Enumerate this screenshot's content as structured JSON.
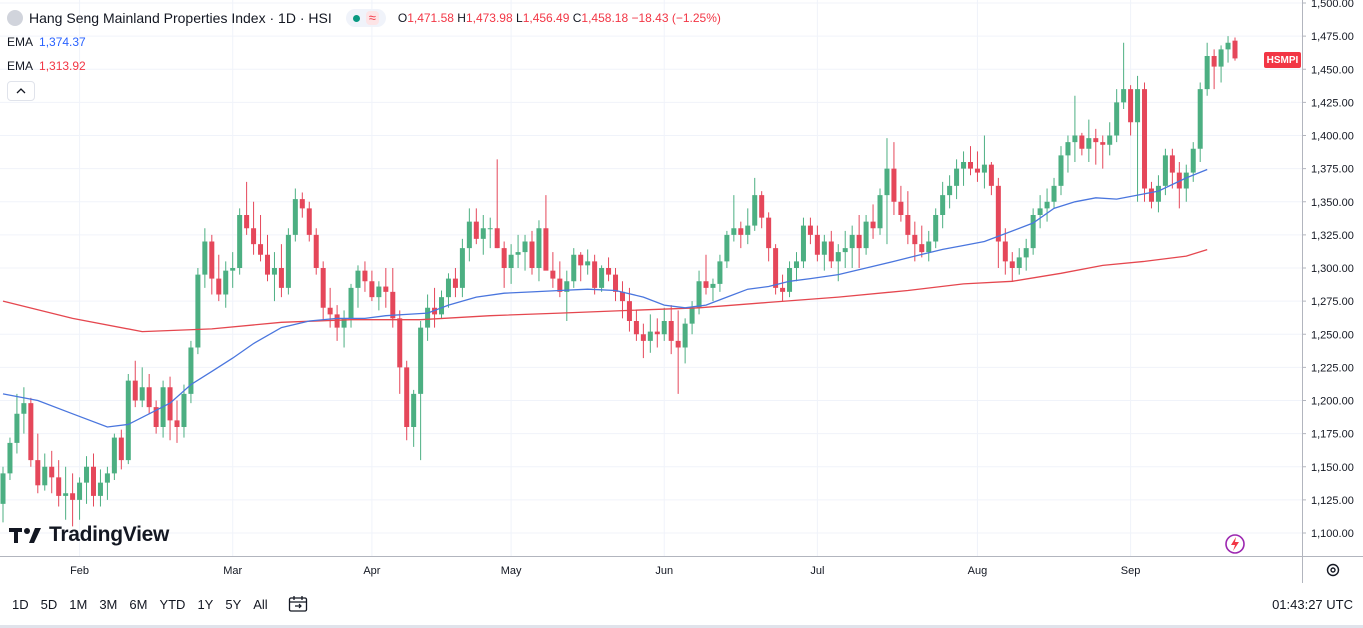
{
  "header": {
    "symbol_title": "Hang Seng Mainland Properties Index · 1D · HSI",
    "ohlc": {
      "open_label": "O",
      "open": "1,471.58",
      "high_label": "H",
      "high": "1,473.98",
      "low_label": "L",
      "low": "1,456.49",
      "close_label": "C",
      "close": "1,458.18",
      "change": "−18.43 (−1.25%)"
    }
  },
  "indicators": [
    {
      "label": "EMA",
      "value": "1,374.37",
      "color": "#2962ff"
    },
    {
      "label": "EMA",
      "value": "1,313.92",
      "color": "#f23645"
    }
  ],
  "collapse_glyph": "^",
  "symbol_tag": "HSMPI",
  "logo_text": "TradingView",
  "logo_mark": "TV",
  "timeframes": [
    "1D",
    "5D",
    "1M",
    "3M",
    "6M",
    "YTD",
    "1Y",
    "5Y",
    "All"
  ],
  "clock": "01:43:27 UTC",
  "colors": {
    "up": "#4caf82",
    "down": "#e5475a",
    "ema_fast": "#4a76de",
    "ema_slow": "#e5474f",
    "grid": "#f0f3fa"
  },
  "chart_data": {
    "type": "candlestick",
    "title": "Hang Seng Mainland Properties Index · 1D · HSI",
    "y_ticks": [
      "1,100.00",
      "1,125.00",
      "1,150.00",
      "1,175.00",
      "1,200.00",
      "1,225.00",
      "1,250.00",
      "1,275.00",
      "1,300.00",
      "1,325.00",
      "1,350.00",
      "1,375.00",
      "1,400.00",
      "1,425.00",
      "1,450.00",
      "1,475.00",
      "1,500.00"
    ],
    "y_tick_values": [
      1100,
      1125,
      1150,
      1175,
      1200,
      1225,
      1250,
      1275,
      1300,
      1325,
      1350,
      1375,
      1400,
      1425,
      1450,
      1475,
      1500
    ],
    "ylim": [
      1082,
      1501
    ],
    "x_labels": [
      {
        "label": "Feb",
        "index": 11
      },
      {
        "label": "Mar",
        "index": 33
      },
      {
        "label": "Apr",
        "index": 53
      },
      {
        "label": "May",
        "index": 73
      },
      {
        "label": "Jun",
        "index": 95
      },
      {
        "label": "Jul",
        "index": 117
      },
      {
        "label": "Aug",
        "index": 140
      },
      {
        "label": "Sep",
        "index": 162
      }
    ],
    "x_range": [
      0,
      179
    ],
    "candles": [
      [
        1122,
        1150,
        1108,
        1145
      ],
      [
        1145,
        1172,
        1140,
        1168
      ],
      [
        1168,
        1205,
        1160,
        1190
      ],
      [
        1190,
        1210,
        1175,
        1198
      ],
      [
        1198,
        1202,
        1150,
        1155
      ],
      [
        1155,
        1175,
        1130,
        1136
      ],
      [
        1136,
        1160,
        1132,
        1150
      ],
      [
        1150,
        1162,
        1130,
        1142
      ],
      [
        1142,
        1155,
        1120,
        1128
      ],
      [
        1128,
        1150,
        1110,
        1130
      ],
      [
        1130,
        1145,
        1105,
        1125
      ],
      [
        1125,
        1142,
        1110,
        1138
      ],
      [
        1138,
        1158,
        1122,
        1150
      ],
      [
        1150,
        1160,
        1120,
        1128
      ],
      [
        1128,
        1148,
        1120,
        1138
      ],
      [
        1138,
        1150,
        1125,
        1145
      ],
      [
        1145,
        1175,
        1140,
        1172
      ],
      [
        1172,
        1178,
        1148,
        1155
      ],
      [
        1155,
        1220,
        1152,
        1215
      ],
      [
        1215,
        1230,
        1195,
        1200
      ],
      [
        1200,
        1225,
        1195,
        1210
      ],
      [
        1210,
        1220,
        1190,
        1195
      ],
      [
        1195,
        1200,
        1175,
        1180
      ],
      [
        1180,
        1215,
        1172,
        1210
      ],
      [
        1210,
        1218,
        1170,
        1185
      ],
      [
        1185,
        1200,
        1168,
        1180
      ],
      [
        1180,
        1212,
        1172,
        1205
      ],
      [
        1205,
        1245,
        1198,
        1240
      ],
      [
        1240,
        1300,
        1235,
        1295
      ],
      [
        1295,
        1330,
        1285,
        1320
      ],
      [
        1320,
        1325,
        1280,
        1292
      ],
      [
        1292,
        1310,
        1275,
        1280
      ],
      [
        1280,
        1305,
        1270,
        1298
      ],
      [
        1298,
        1312,
        1285,
        1300
      ],
      [
        1300,
        1345,
        1295,
        1340
      ],
      [
        1340,
        1365,
        1325,
        1330
      ],
      [
        1330,
        1350,
        1310,
        1318
      ],
      [
        1318,
        1340,
        1305,
        1310
      ],
      [
        1310,
        1325,
        1290,
        1295
      ],
      [
        1295,
        1312,
        1275,
        1300
      ],
      [
        1300,
        1318,
        1278,
        1285
      ],
      [
        1285,
        1330,
        1280,
        1325
      ],
      [
        1325,
        1360,
        1320,
        1352
      ],
      [
        1352,
        1357,
        1338,
        1345
      ],
      [
        1345,
        1350,
        1320,
        1325
      ],
      [
        1325,
        1330,
        1295,
        1300
      ],
      [
        1300,
        1305,
        1260,
        1270
      ],
      [
        1270,
        1285,
        1255,
        1265
      ],
      [
        1265,
        1272,
        1245,
        1255
      ],
      [
        1255,
        1268,
        1240,
        1262
      ],
      [
        1262,
        1288,
        1255,
        1285
      ],
      [
        1285,
        1302,
        1270,
        1298
      ],
      [
        1298,
        1305,
        1282,
        1290
      ],
      [
        1290,
        1298,
        1275,
        1278
      ],
      [
        1278,
        1290,
        1268,
        1286
      ],
      [
        1286,
        1300,
        1270,
        1282
      ],
      [
        1282,
        1300,
        1255,
        1262
      ],
      [
        1262,
        1268,
        1205,
        1225
      ],
      [
        1225,
        1230,
        1170,
        1180
      ],
      [
        1180,
        1208,
        1165,
        1205
      ],
      [
        1205,
        1260,
        1155,
        1255
      ],
      [
        1255,
        1280,
        1245,
        1270
      ],
      [
        1270,
        1285,
        1255,
        1265
      ],
      [
        1265,
        1283,
        1262,
        1278
      ],
      [
        1278,
        1296,
        1270,
        1292
      ],
      [
        1292,
        1300,
        1278,
        1285
      ],
      [
        1285,
        1322,
        1278,
        1315
      ],
      [
        1315,
        1345,
        1305,
        1335
      ],
      [
        1335,
        1345,
        1318,
        1322
      ],
      [
        1322,
        1340,
        1310,
        1330
      ],
      [
        1330,
        1338,
        1315,
        1330
      ],
      [
        1330,
        1382,
        1315,
        1315
      ],
      [
        1315,
        1320,
        1285,
        1300
      ],
      [
        1300,
        1318,
        1288,
        1310
      ],
      [
        1310,
        1325,
        1300,
        1312
      ],
      [
        1312,
        1325,
        1298,
        1320
      ],
      [
        1320,
        1328,
        1295,
        1300
      ],
      [
        1300,
        1336,
        1290,
        1330
      ],
      [
        1330,
        1355,
        1308,
        1298
      ],
      [
        1298,
        1312,
        1285,
        1292
      ],
      [
        1292,
        1305,
        1278,
        1282
      ],
      [
        1282,
        1298,
        1260,
        1290
      ],
      [
        1290,
        1315,
        1285,
        1310
      ],
      [
        1310,
        1312,
        1290,
        1302
      ],
      [
        1302,
        1314,
        1295,
        1305
      ],
      [
        1305,
        1310,
        1280,
        1285
      ],
      [
        1285,
        1302,
        1282,
        1300
      ],
      [
        1300,
        1308,
        1290,
        1295
      ],
      [
        1295,
        1300,
        1275,
        1282
      ],
      [
        1282,
        1290,
        1262,
        1275
      ],
      [
        1275,
        1285,
        1252,
        1260
      ],
      [
        1260,
        1268,
        1245,
        1250
      ],
      [
        1250,
        1258,
        1232,
        1245
      ],
      [
        1245,
        1265,
        1236,
        1252
      ],
      [
        1252,
        1262,
        1240,
        1250
      ],
      [
        1250,
        1270,
        1245,
        1260
      ],
      [
        1260,
        1272,
        1235,
        1245
      ],
      [
        1245,
        1268,
        1205,
        1240
      ],
      [
        1240,
        1262,
        1228,
        1258
      ],
      [
        1258,
        1275,
        1250,
        1270
      ],
      [
        1270,
        1298,
        1265,
        1290
      ],
      [
        1290,
        1310,
        1280,
        1285
      ],
      [
        1285,
        1292,
        1275,
        1288
      ],
      [
        1288,
        1310,
        1282,
        1305
      ],
      [
        1305,
        1328,
        1300,
        1325
      ],
      [
        1325,
        1355,
        1320,
        1330
      ],
      [
        1330,
        1335,
        1315,
        1325
      ],
      [
        1325,
        1345,
        1318,
        1332
      ],
      [
        1332,
        1368,
        1328,
        1355
      ],
      [
        1355,
        1358,
        1330,
        1338
      ],
      [
        1338,
        1342,
        1305,
        1315
      ],
      [
        1315,
        1318,
        1280,
        1285
      ],
      [
        1285,
        1295,
        1275,
        1282
      ],
      [
        1282,
        1305,
        1278,
        1300
      ],
      [
        1300,
        1312,
        1290,
        1305
      ],
      [
        1305,
        1338,
        1300,
        1332
      ],
      [
        1332,
        1338,
        1318,
        1325
      ],
      [
        1325,
        1332,
        1305,
        1310
      ],
      [
        1310,
        1325,
        1298,
        1320
      ],
      [
        1320,
        1328,
        1300,
        1305
      ],
      [
        1305,
        1318,
        1290,
        1312
      ],
      [
        1312,
        1328,
        1300,
        1315
      ],
      [
        1315,
        1332,
        1300,
        1325
      ],
      [
        1325,
        1340,
        1300,
        1315
      ],
      [
        1315,
        1340,
        1310,
        1335
      ],
      [
        1335,
        1348,
        1322,
        1330
      ],
      [
        1330,
        1360,
        1325,
        1355
      ],
      [
        1355,
        1398,
        1318,
        1375
      ],
      [
        1375,
        1395,
        1340,
        1350
      ],
      [
        1350,
        1362,
        1335,
        1340
      ],
      [
        1340,
        1358,
        1318,
        1325
      ],
      [
        1325,
        1335,
        1305,
        1318
      ],
      [
        1318,
        1332,
        1308,
        1312
      ],
      [
        1312,
        1328,
        1305,
        1320
      ],
      [
        1320,
        1345,
        1315,
        1340
      ],
      [
        1340,
        1365,
        1330,
        1355
      ],
      [
        1355,
        1370,
        1345,
        1362
      ],
      [
        1362,
        1382,
        1352,
        1375
      ],
      [
        1375,
        1388,
        1362,
        1380
      ],
      [
        1380,
        1392,
        1370,
        1375
      ],
      [
        1375,
        1388,
        1365,
        1372
      ],
      [
        1372,
        1400,
        1360,
        1378
      ],
      [
        1378,
        1380,
        1355,
        1362
      ],
      [
        1362,
        1368,
        1300,
        1320
      ],
      [
        1320,
        1330,
        1295,
        1305
      ],
      [
        1305,
        1312,
        1290,
        1300
      ],
      [
        1300,
        1315,
        1295,
        1308
      ],
      [
        1308,
        1322,
        1298,
        1315
      ],
      [
        1315,
        1345,
        1310,
        1340
      ],
      [
        1340,
        1355,
        1330,
        1345
      ],
      [
        1345,
        1360,
        1335,
        1350
      ],
      [
        1350,
        1368,
        1345,
        1362
      ],
      [
        1362,
        1392,
        1355,
        1385
      ],
      [
        1385,
        1400,
        1372,
        1395
      ],
      [
        1395,
        1430,
        1380,
        1400
      ],
      [
        1400,
        1402,
        1385,
        1390
      ],
      [
        1390,
        1412,
        1380,
        1398
      ],
      [
        1398,
        1405,
        1378,
        1395
      ],
      [
        1395,
        1400,
        1375,
        1393
      ],
      [
        1393,
        1410,
        1385,
        1400
      ],
      [
        1400,
        1435,
        1395,
        1425
      ],
      [
        1425,
        1470,
        1420,
        1435
      ],
      [
        1435,
        1438,
        1400,
        1410
      ],
      [
        1410,
        1445,
        1350,
        1435
      ],
      [
        1435,
        1440,
        1350,
        1360
      ],
      [
        1360,
        1365,
        1345,
        1350
      ],
      [
        1350,
        1370,
        1342,
        1362
      ],
      [
        1362,
        1390,
        1355,
        1385
      ],
      [
        1385,
        1390,
        1360,
        1372
      ],
      [
        1372,
        1380,
        1345,
        1360
      ],
      [
        1360,
        1378,
        1350,
        1372
      ],
      [
        1372,
        1395,
        1365,
        1390
      ],
      [
        1390,
        1440,
        1380,
        1435
      ],
      [
        1435,
        1470,
        1430,
        1460
      ],
      [
        1460,
        1465,
        1435,
        1452
      ],
      [
        1452,
        1468,
        1440,
        1465
      ],
      [
        1465,
        1475,
        1455,
        1470
      ],
      [
        1471.58,
        1473.98,
        1456.49,
        1458.18
      ]
    ],
    "ema_fast": [
      [
        0,
        1205
      ],
      [
        5,
        1200
      ],
      [
        10,
        1190
      ],
      [
        15,
        1180
      ],
      [
        18,
        1182
      ],
      [
        21,
        1190
      ],
      [
        24,
        1198
      ],
      [
        27,
        1212
      ],
      [
        30,
        1222
      ],
      [
        33,
        1232
      ],
      [
        36,
        1243
      ],
      [
        40,
        1255
      ],
      [
        44,
        1260
      ],
      [
        48,
        1262
      ],
      [
        52,
        1262
      ],
      [
        55,
        1264
      ],
      [
        58,
        1265
      ],
      [
        61,
        1266
      ],
      [
        64,
        1272
      ],
      [
        68,
        1278
      ],
      [
        72,
        1281
      ],
      [
        76,
        1282
      ],
      [
        80,
        1283
      ],
      [
        84,
        1284
      ],
      [
        88,
        1283
      ],
      [
        92,
        1278
      ],
      [
        95,
        1272
      ],
      [
        98,
        1270
      ],
      [
        101,
        1272
      ],
      [
        104,
        1278
      ],
      [
        107,
        1284
      ],
      [
        110,
        1286
      ],
      [
        113,
        1290
      ],
      [
        116,
        1292
      ],
      [
        120,
        1295
      ],
      [
        124,
        1300
      ],
      [
        128,
        1305
      ],
      [
        131,
        1309
      ],
      [
        135,
        1314
      ],
      [
        138,
        1317
      ],
      [
        141,
        1320
      ],
      [
        144,
        1326
      ],
      [
        148,
        1334
      ],
      [
        151,
        1345
      ],
      [
        154,
        1350
      ],
      [
        157,
        1353
      ],
      [
        160,
        1352
      ],
      [
        163,
        1355
      ],
      [
        166,
        1358
      ],
      [
        170,
        1368
      ],
      [
        173,
        1374.37
      ]
    ],
    "ema_slow": [
      [
        0,
        1275
      ],
      [
        10,
        1262
      ],
      [
        20,
        1252
      ],
      [
        30,
        1254
      ],
      [
        40,
        1259
      ],
      [
        50,
        1261
      ],
      [
        60,
        1261
      ],
      [
        70,
        1264
      ],
      [
        80,
        1266
      ],
      [
        90,
        1268
      ],
      [
        100,
        1270
      ],
      [
        110,
        1274
      ],
      [
        120,
        1278
      ],
      [
        130,
        1283
      ],
      [
        138,
        1288
      ],
      [
        145,
        1290
      ],
      [
        152,
        1296
      ],
      [
        158,
        1302
      ],
      [
        164,
        1305
      ],
      [
        170,
        1309
      ],
      [
        173,
        1313.92
      ]
    ]
  }
}
